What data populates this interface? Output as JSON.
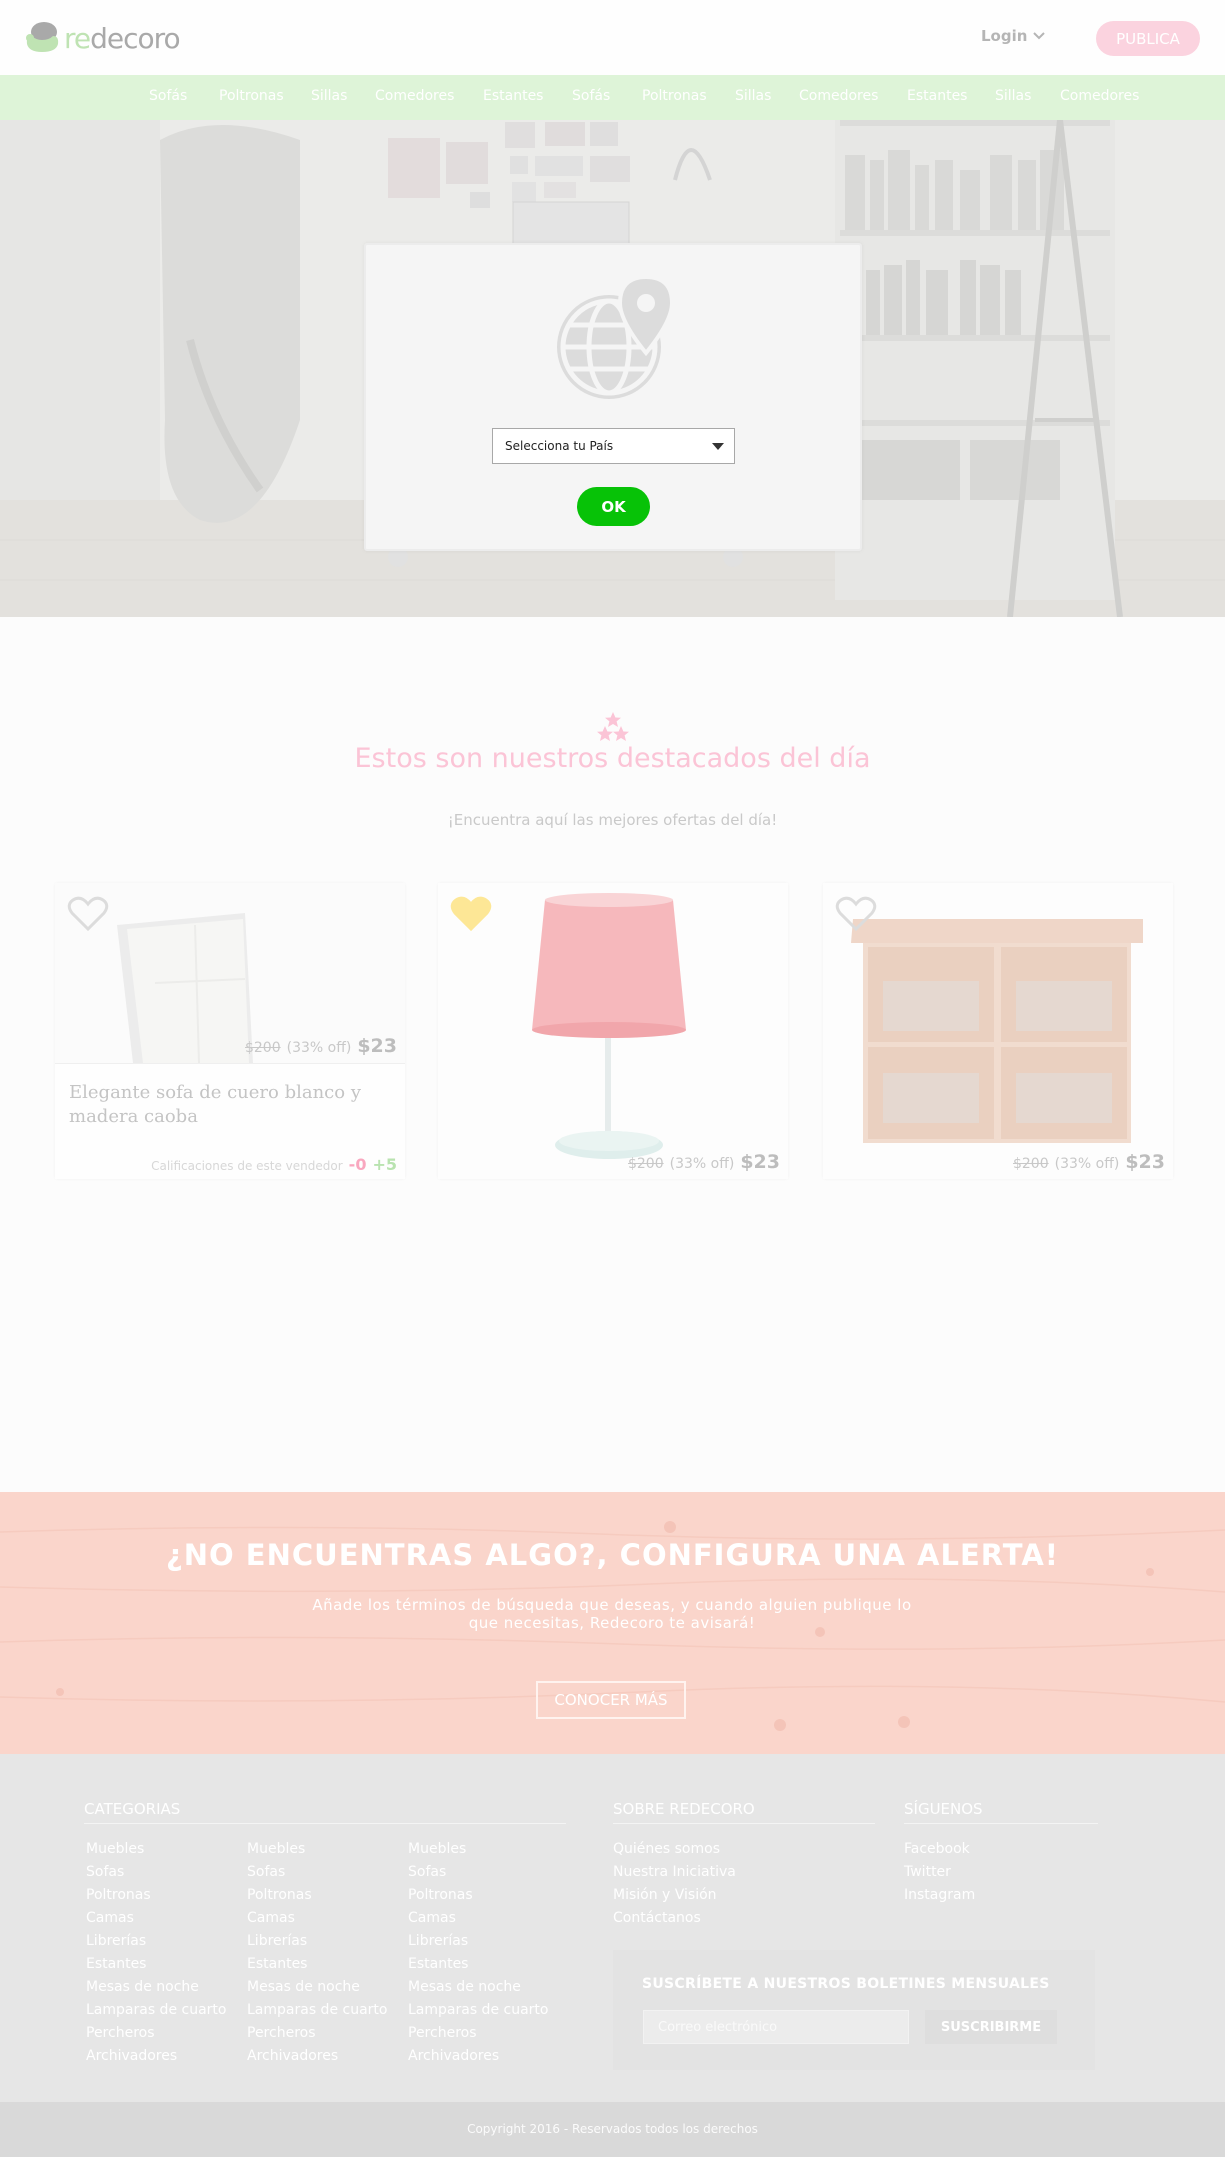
{
  "header": {
    "logo_re": "re",
    "logo_rest": "decoro",
    "login_label": "Login",
    "publish_label": "PUBLICA"
  },
  "nav": {
    "items": [
      "Sofás",
      "Poltronas",
      "Sillas",
      "Comedores",
      "Estantes",
      "Sofás",
      "Poltronas",
      "Sillas",
      "Comedores",
      "Estantes",
      "Sillas",
      "Comedores"
    ]
  },
  "modal": {
    "select_placeholder": "Selecciona tu País",
    "ok_label": "OK"
  },
  "featured": {
    "title": "Estos son nuestros destacados del día",
    "subtitle": "¡Encuentra aquí las mejores ofertas del día!",
    "cards": [
      {
        "old_price": "$200",
        "discount": "(33% off)",
        "price": "$23",
        "title": "Elegante sofa de cuero blanco y madera caoba",
        "ratings_label": "Calificaciones de este vendedor",
        "neg": "-0",
        "pos": "+5",
        "favorite": false
      },
      {
        "old_price": "$200",
        "discount": "(33% off)",
        "price": "$23",
        "favorite": true
      },
      {
        "old_price": "$200",
        "discount": "(33% off)",
        "price": "$23",
        "favorite": false
      }
    ]
  },
  "alert": {
    "title": "¿NO ENCUENTRAS ALGO?, CONFIGURA UNA ALERTA!",
    "text": "Añade los términos de búsqueda que deseas, y cuando alguien publique lo que necesitas, Redecoro te avisará!",
    "button_label": "CONOCER MÁS"
  },
  "footer": {
    "categories_heading": "CATEGORIAS",
    "categories": [
      "Muebles",
      "Sofas",
      "Poltronas",
      "Camas",
      "Librerías",
      "Estantes",
      "Mesas de noche",
      "Lamparas de cuarto",
      "Percheros",
      "Archivadores"
    ],
    "about_heading": "SOBRE REDECORO",
    "about_links": [
      "Quiénes somos",
      "Nuestra Iniciativa",
      "Misión y Visión",
      "Contáctanos"
    ],
    "follow_heading": "SÍGUENOS",
    "follow_links": [
      "Facebook",
      "Twitter",
      "Instagram"
    ],
    "newsletter_title": "SUSCRÍBETE A NUESTROS BOLETINES MENSUALES",
    "newsletter_placeholder": "Correo electrónico",
    "newsletter_button": "SUSCRIBIRME",
    "copyright": "Copyright 2016 - Reservados todos los derechos"
  }
}
